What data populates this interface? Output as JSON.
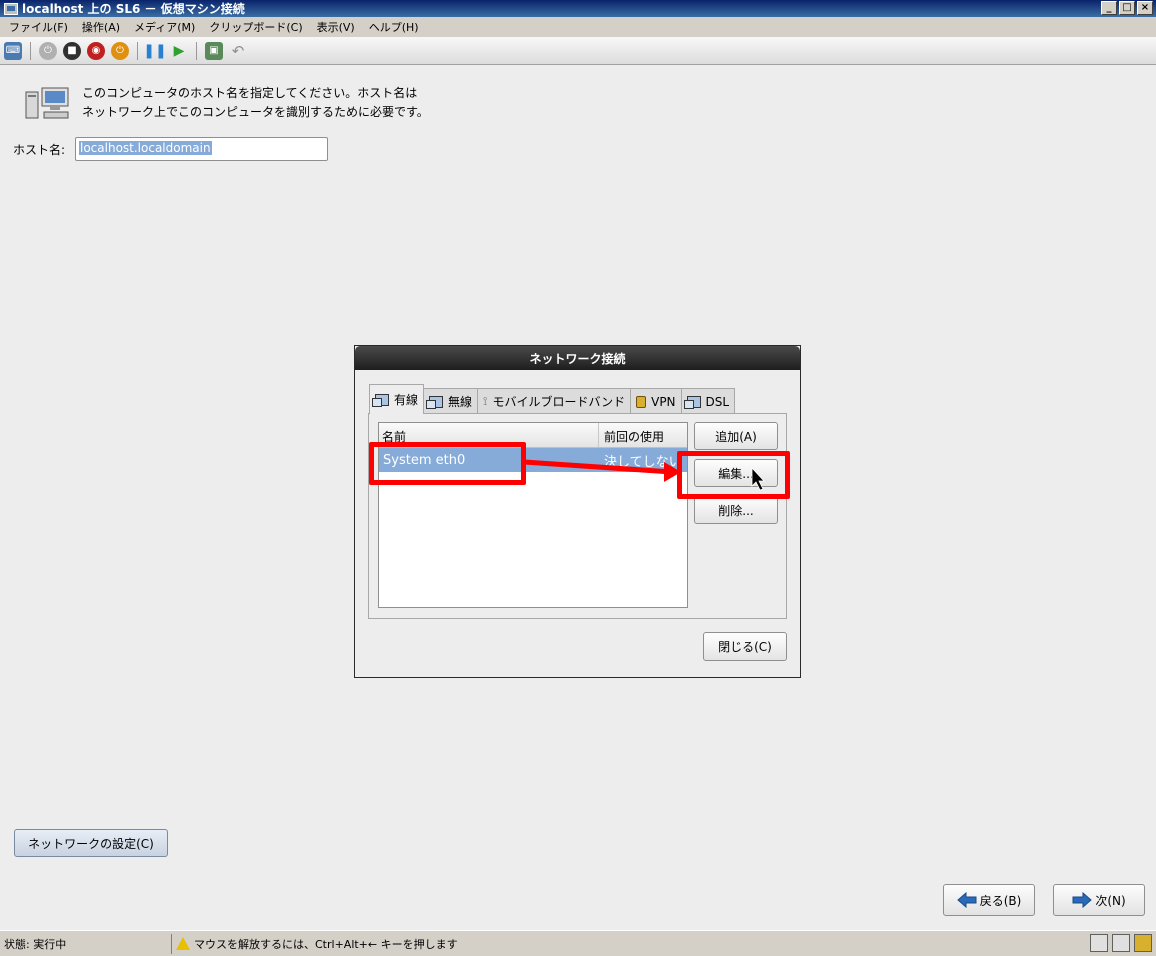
{
  "window": {
    "title": "localhost 上の SL6 － 仮想マシン接続",
    "controls": [
      "_",
      "□",
      "×"
    ]
  },
  "menu": [
    "ファイル(F)",
    "操作(A)",
    "メディア(M)",
    "クリップボード(C)",
    "表示(V)",
    "ヘルプ(H)"
  ],
  "toolbar": {
    "icons": [
      "ctrl-alt-del-icon",
      "start-icon",
      "stop-icon",
      "shutdown-icon",
      "power-icon",
      "pause-icon",
      "resume-icon",
      "snapshot-icon",
      "revert-icon"
    ]
  },
  "installer": {
    "intro_line1": "このコンピュータのホスト名を指定してください。ホスト名は",
    "intro_line2": "ネットワーク上でこのコンピュータを識別するために必要です。",
    "hostname_label": "ホスト名:",
    "hostname_value": "localhost.localdomain",
    "network_settings_button": "ネットワークの設定(C)",
    "back_button": "戻る(B)",
    "next_button": "次(N)"
  },
  "dialog": {
    "title": "ネットワーク接続",
    "tabs": [
      {
        "label": "有線",
        "active": true
      },
      {
        "label": "無線",
        "active": false
      },
      {
        "label": "モバイルブロードバンド",
        "active": false
      },
      {
        "label": "VPN",
        "active": false
      },
      {
        "label": "DSL",
        "active": false
      }
    ],
    "columns": {
      "name": "名前",
      "last_used": "前回の使用"
    },
    "rows": [
      {
        "name": "System eth0",
        "last_used": "決してしない"
      }
    ],
    "add_button": "追加(A)",
    "edit_button": "編集...",
    "delete_button": "削除...",
    "close_button": "閉じる(C)"
  },
  "status": {
    "state": "状態: 実行中",
    "message": "マウスを解放するには、Ctrl+Alt+← キーを押します"
  },
  "colors": {
    "selection": "#86abd9",
    "annotation": "#ff0000",
    "titlebar": "#0a246a"
  }
}
